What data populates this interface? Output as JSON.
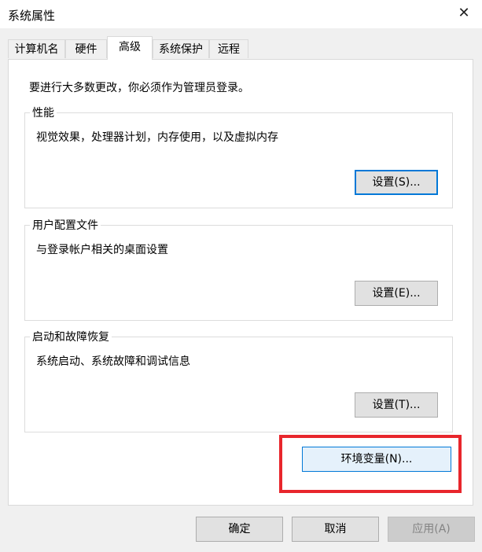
{
  "window": {
    "title": "系统属性",
    "close_glyph": "✕"
  },
  "tabs": [
    {
      "label": "计算机名"
    },
    {
      "label": "硬件"
    },
    {
      "label": "高级"
    },
    {
      "label": "系统保护"
    },
    {
      "label": "远程"
    }
  ],
  "active_tab": "高级",
  "panel": {
    "note": "要进行大多数更改，你必须作为管理员登录。",
    "performance": {
      "legend": "性能",
      "description": "视觉效果，处理器计划，内存使用，以及虚拟内存",
      "button": "设置(S)..."
    },
    "user_profiles": {
      "legend": "用户配置文件",
      "description": "与登录帐户相关的桌面设置",
      "button": "设置(E)..."
    },
    "startup_recovery": {
      "legend": "启动和故障恢复",
      "description": "系统启动、系统故障和调试信息",
      "button": "设置(T)..."
    },
    "env_button": "环境变量(N)..."
  },
  "footer": {
    "ok": "确定",
    "cancel": "取消",
    "apply": "应用(A)"
  },
  "colors": {
    "highlight": "#e8262c",
    "focus": "#0078d7"
  }
}
